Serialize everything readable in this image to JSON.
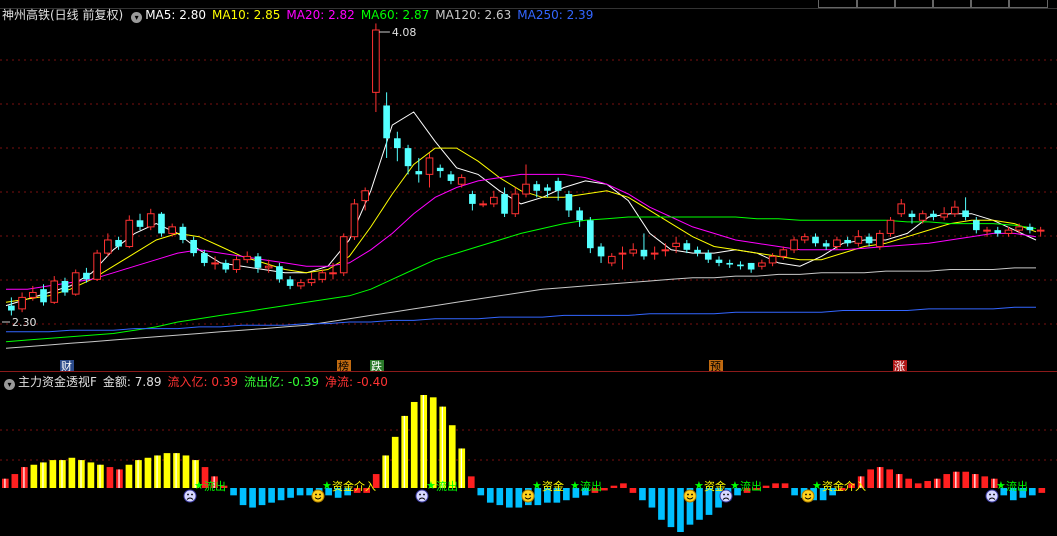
{
  "main_legend": {
    "title": "神州高铁(日线 前复权)",
    "items": [
      {
        "label": "MA5: 2.80",
        "color": "#ffffff"
      },
      {
        "label": "MA10: 2.85",
        "color": "#ffff00"
      },
      {
        "label": "MA20: 2.82",
        "color": "#ff00ff"
      },
      {
        "label": "MA60: 2.87",
        "color": "#00ff00"
      },
      {
        "label": "MA120: 2.63",
        "color": "#c8c8c8"
      },
      {
        "label": "MA250: 2.39",
        "color": "#3366ff"
      }
    ]
  },
  "sub_legend": {
    "title": "主力资金透视F",
    "items": [
      {
        "label": "金额: 7.89",
        "color": "#e0e0e0"
      },
      {
        "label": "流入亿: 0.39",
        "color": "#ff3333"
      },
      {
        "label": "流出亿: -0.39",
        "color": "#33ff33"
      },
      {
        "label": "净流: -0.40",
        "color": "#ff3333"
      }
    ]
  },
  "annotations": {
    "high_price": "4.08",
    "low_price": "2.30"
  },
  "event_tags": [
    {
      "label": "财",
      "bg": "#2a4a8a",
      "color": "#ffffff"
    },
    {
      "label": "榜",
      "bg": "#c06a10",
      "color": "#000000"
    },
    {
      "label": "跌",
      "bg": "#2a7a2a",
      "color": "#ffffff"
    },
    {
      "label": "预",
      "bg": "#c06a10",
      "color": "#000000"
    },
    {
      "label": "涨",
      "bg": "#b01818",
      "color": "#ffffff"
    }
  ],
  "signals": [
    {
      "face": "sad",
      "text": "流出",
      "text_color": "#00ff00"
    },
    {
      "face": "happy",
      "text": "资金介入",
      "text_color": "#ffff00"
    },
    {
      "face": "sad",
      "text": "流出",
      "text_color": "#00ff00"
    },
    {
      "face": "happy",
      "text": "资金",
      "text_color": "#ffff00"
    },
    {
      "face": "none",
      "text": "流出",
      "text_color": "#00ff00"
    },
    {
      "face": "happy",
      "text": "资金",
      "text_color": "#ffff00"
    },
    {
      "face": "sad",
      "text": "流出",
      "text_color": "#00ff00"
    },
    {
      "face": "happy",
      "text": "资金介入",
      "text_color": "#ffff00"
    },
    {
      "face": "sad",
      "text": "流出",
      "text_color": "#00ff00"
    }
  ],
  "colors": {
    "up_candle": "#ff3232",
    "down_candle": "#54ffff",
    "inflow_bar": "#ff2020",
    "inflow_bar_strong": "#ffff00",
    "outflow_bar": "#00c0ff",
    "grid": "#7a1010"
  },
  "chart_data": {
    "type": "candlestick",
    "y_axis_prices": [
      2.3,
      4.08
    ],
    "candles": [
      [
        2.4,
        2.37,
        2.45,
        2.34
      ],
      [
        2.38,
        2.45,
        2.48,
        2.36
      ],
      [
        2.45,
        2.48,
        2.52,
        2.43
      ],
      [
        2.5,
        2.42,
        2.53,
        2.4
      ],
      [
        2.42,
        2.55,
        2.58,
        2.41
      ],
      [
        2.55,
        2.48,
        2.57,
        2.46
      ],
      [
        2.47,
        2.6,
        2.62,
        2.46
      ],
      [
        2.6,
        2.56,
        2.63,
        2.54
      ],
      [
        2.56,
        2.72,
        2.74,
        2.55
      ],
      [
        2.72,
        2.8,
        2.84,
        2.7
      ],
      [
        2.8,
        2.76,
        2.82,
        2.74
      ],
      [
        2.76,
        2.92,
        2.95,
        2.75
      ],
      [
        2.92,
        2.88,
        2.96,
        2.86
      ],
      [
        2.88,
        2.96,
        2.99,
        2.86
      ],
      [
        2.96,
        2.84,
        2.97,
        2.82
      ],
      [
        2.84,
        2.88,
        2.9,
        2.82
      ],
      [
        2.88,
        2.8,
        2.9,
        2.78
      ],
      [
        2.8,
        2.72,
        2.82,
        2.7
      ],
      [
        2.72,
        2.66,
        2.74,
        2.64
      ],
      [
        2.66,
        2.66,
        2.7,
        2.62
      ],
      [
        2.66,
        2.62,
        2.68,
        2.6
      ],
      [
        2.62,
        2.68,
        2.7,
        2.6
      ],
      [
        2.68,
        2.7,
        2.73,
        2.66
      ],
      [
        2.7,
        2.63,
        2.72,
        2.6
      ],
      [
        2.63,
        2.64,
        2.68,
        2.6
      ],
      [
        2.64,
        2.56,
        2.66,
        2.54
      ],
      [
        2.56,
        2.52,
        2.58,
        2.5
      ],
      [
        2.52,
        2.54,
        2.56,
        2.5
      ],
      [
        2.54,
        2.56,
        2.6,
        2.52
      ],
      [
        2.56,
        2.6,
        2.62,
        2.54
      ],
      [
        2.6,
        2.6,
        2.66,
        2.56
      ],
      [
        2.6,
        2.82,
        2.84,
        2.58
      ],
      [
        2.82,
        3.02,
        3.05,
        2.8
      ],
      [
        3.04,
        3.1,
        3.12,
        2.98
      ],
      [
        3.7,
        4.08,
        4.12,
        3.58
      ],
      [
        3.62,
        3.42,
        3.7,
        3.3
      ],
      [
        3.42,
        3.36,
        3.46,
        3.28
      ],
      [
        3.36,
        3.25,
        3.38,
        3.2
      ],
      [
        3.22,
        3.2,
        3.3,
        3.15
      ],
      [
        3.2,
        3.3,
        3.33,
        3.12
      ],
      [
        3.24,
        3.22,
        3.26,
        3.18
      ],
      [
        3.2,
        3.16,
        3.22,
        3.14
      ],
      [
        3.14,
        3.18,
        3.2,
        3.12
      ],
      [
        3.08,
        3.02,
        3.1,
        2.98
      ],
      [
        3.02,
        3.02,
        3.04,
        3.0
      ],
      [
        3.02,
        3.06,
        3.1,
        3.0
      ],
      [
        3.08,
        2.96,
        3.12,
        2.94
      ],
      [
        2.96,
        3.08,
        3.12,
        2.94
      ],
      [
        3.08,
        3.14,
        3.26,
        3.06
      ],
      [
        3.14,
        3.1,
        3.16,
        3.06
      ],
      [
        3.12,
        3.1,
        3.14,
        3.06
      ],
      [
        3.16,
        3.1,
        3.18,
        3.04
      ],
      [
        3.08,
        2.98,
        3.1,
        2.94
      ],
      [
        2.98,
        2.92,
        3.0,
        2.88
      ],
      [
        2.92,
        2.75,
        2.94,
        2.72
      ],
      [
        2.76,
        2.7,
        2.78,
        2.66
      ],
      [
        2.66,
        2.7,
        2.72,
        2.64
      ],
      [
        2.72,
        2.72,
        2.76,
        2.62
      ],
      [
        2.72,
        2.74,
        2.78,
        2.7
      ],
      [
        2.74,
        2.7,
        2.84,
        2.68
      ],
      [
        2.72,
        2.72,
        2.76,
        2.68
      ],
      [
        2.74,
        2.74,
        2.78,
        2.7
      ],
      [
        2.76,
        2.78,
        2.82,
        2.72
      ],
      [
        2.78,
        2.74,
        2.8,
        2.72
      ],
      [
        2.74,
        2.72,
        2.76,
        2.7
      ],
      [
        2.72,
        2.68,
        2.74,
        2.66
      ],
      [
        2.68,
        2.66,
        2.7,
        2.64
      ],
      [
        2.66,
        2.65,
        2.68,
        2.63
      ],
      [
        2.65,
        2.64,
        2.67,
        2.62
      ],
      [
        2.66,
        2.62,
        2.66,
        2.6
      ],
      [
        2.64,
        2.66,
        2.68,
        2.62
      ],
      [
        2.66,
        2.7,
        2.72,
        2.64
      ],
      [
        2.7,
        2.74,
        2.76,
        2.68
      ],
      [
        2.74,
        2.8,
        2.82,
        2.72
      ],
      [
        2.8,
        2.82,
        2.84,
        2.78
      ],
      [
        2.82,
        2.78,
        2.84,
        2.76
      ],
      [
        2.78,
        2.76,
        2.8,
        2.74
      ],
      [
        2.76,
        2.8,
        2.82,
        2.74
      ],
      [
        2.8,
        2.78,
        2.82,
        2.76
      ],
      [
        2.78,
        2.82,
        2.86,
        2.76
      ],
      [
        2.82,
        2.78,
        2.84,
        2.76
      ],
      [
        2.76,
        2.84,
        2.86,
        2.74
      ],
      [
        2.84,
        2.92,
        2.94,
        2.82
      ],
      [
        2.96,
        3.02,
        3.05,
        2.94
      ],
      [
        2.96,
        2.94,
        2.98,
        2.9
      ],
      [
        2.92,
        2.96,
        2.98,
        2.9
      ],
      [
        2.96,
        2.94,
        2.98,
        2.92
      ],
      [
        2.94,
        2.96,
        3.0,
        2.92
      ],
      [
        2.96,
        3.0,
        3.04,
        2.94
      ],
      [
        2.98,
        2.94,
        3.06,
        2.92
      ],
      [
        2.92,
        2.86,
        2.94,
        2.84
      ],
      [
        2.86,
        2.86,
        2.88,
        2.82
      ],
      [
        2.86,
        2.84,
        2.88,
        2.82
      ],
      [
        2.84,
        2.86,
        2.88,
        2.82
      ],
      [
        2.86,
        2.88,
        2.9,
        2.84
      ],
      [
        2.88,
        2.86,
        2.9,
        2.84
      ],
      [
        2.86,
        2.86,
        2.88,
        2.82
      ]
    ],
    "ma_series": [
      {
        "name": "MA5",
        "color": "#ffffff",
        "values": [
          2.4,
          2.44,
          2.48,
          2.52,
          2.6,
          2.74,
          2.84,
          2.9,
          2.84,
          2.74,
          2.66,
          2.64,
          2.62,
          2.6,
          2.6,
          2.64,
          2.8,
          3.1,
          3.5,
          3.58,
          3.4,
          3.24,
          3.2,
          3.1,
          3.02,
          3.06,
          3.12,
          3.16,
          3.14,
          3.04,
          2.84,
          2.74,
          2.72,
          2.72,
          2.74,
          2.72,
          2.66,
          2.64,
          2.7,
          2.78,
          2.8,
          2.8,
          2.84,
          2.94,
          2.96,
          2.96,
          2.92,
          2.86,
          2.8
        ]
      },
      {
        "name": "MA10",
        "color": "#ffff00",
        "values": [
          2.42,
          2.44,
          2.46,
          2.5,
          2.56,
          2.64,
          2.72,
          2.8,
          2.84,
          2.82,
          2.76,
          2.7,
          2.66,
          2.62,
          2.6,
          2.62,
          2.7,
          2.88,
          3.08,
          3.26,
          3.36,
          3.36,
          3.28,
          3.18,
          3.1,
          3.06,
          3.06,
          3.08,
          3.1,
          3.06,
          2.98,
          2.9,
          2.82,
          2.76,
          2.74,
          2.72,
          2.7,
          2.68,
          2.68,
          2.72,
          2.76,
          2.78,
          2.82,
          2.86,
          2.9,
          2.92,
          2.92,
          2.9,
          2.85
        ]
      },
      {
        "name": "MA20",
        "color": "#ff00ff",
        "values": [
          2.5,
          2.5,
          2.52,
          2.54,
          2.56,
          2.6,
          2.64,
          2.68,
          2.72,
          2.74,
          2.72,
          2.7,
          2.68,
          2.66,
          2.64,
          2.64,
          2.66,
          2.74,
          2.84,
          2.96,
          3.06,
          3.12,
          3.16,
          3.18,
          3.2,
          3.2,
          3.2,
          3.18,
          3.14,
          3.08,
          3.0,
          2.94,
          2.88,
          2.84,
          2.8,
          2.78,
          2.76,
          2.74,
          2.74,
          2.74,
          2.75,
          2.76,
          2.77,
          2.78,
          2.8,
          2.82,
          2.84,
          2.84,
          2.82
        ]
      },
      {
        "name": "MA60",
        "color": "#00ff00",
        "values": [
          2.18,
          2.19,
          2.2,
          2.21,
          2.22,
          2.23,
          2.25,
          2.27,
          2.3,
          2.32,
          2.34,
          2.36,
          2.38,
          2.4,
          2.42,
          2.44,
          2.46,
          2.5,
          2.56,
          2.62,
          2.68,
          2.72,
          2.76,
          2.8,
          2.84,
          2.87,
          2.9,
          2.92,
          2.93,
          2.94,
          2.94,
          2.94,
          2.94,
          2.94,
          2.94,
          2.93,
          2.93,
          2.92,
          2.92,
          2.92,
          2.92,
          2.92,
          2.91,
          2.91,
          2.9,
          2.9,
          2.9,
          2.89,
          2.87
        ]
      },
      {
        "name": "MA120",
        "color": "#c8c8c8",
        "values": [
          2.14,
          2.15,
          2.16,
          2.17,
          2.18,
          2.19,
          2.2,
          2.21,
          2.22,
          2.23,
          2.24,
          2.25,
          2.26,
          2.27,
          2.28,
          2.3,
          2.32,
          2.34,
          2.36,
          2.38,
          2.4,
          2.42,
          2.44,
          2.46,
          2.48,
          2.5,
          2.51,
          2.52,
          2.53,
          2.54,
          2.55,
          2.56,
          2.57,
          2.57,
          2.58,
          2.58,
          2.59,
          2.59,
          2.6,
          2.6,
          2.6,
          2.61,
          2.61,
          2.61,
          2.62,
          2.62,
          2.62,
          2.63,
          2.63
        ]
      },
      {
        "name": "MA250",
        "color": "#3366ff",
        "values": [
          2.24,
          2.24,
          2.24,
          2.25,
          2.25,
          2.25,
          2.26,
          2.26,
          2.26,
          2.27,
          2.27,
          2.28,
          2.28,
          2.28,
          2.29,
          2.29,
          2.3,
          2.3,
          2.31,
          2.31,
          2.32,
          2.32,
          2.32,
          2.33,
          2.33,
          2.33,
          2.34,
          2.34,
          2.34,
          2.34,
          2.35,
          2.35,
          2.35,
          2.35,
          2.36,
          2.36,
          2.36,
          2.36,
          2.36,
          2.37,
          2.37,
          2.37,
          2.37,
          2.38,
          2.38,
          2.38,
          2.38,
          2.39,
          2.39
        ]
      }
    ],
    "fund_flow": [
      0.08,
      0.12,
      0.18,
      0.2,
      0.22,
      0.24,
      0.24,
      0.26,
      0.24,
      0.22,
      0.2,
      0.18,
      0.16,
      0.2,
      0.24,
      0.26,
      0.28,
      0.3,
      0.3,
      0.28,
      0.24,
      0.18,
      0.1,
      0.02,
      -0.06,
      -0.14,
      -0.16,
      -0.14,
      -0.12,
      -0.1,
      -0.08,
      -0.06,
      -0.06,
      -0.06,
      -0.06,
      -0.08,
      -0.06,
      -0.04,
      -0.04,
      0.12,
      0.28,
      0.44,
      0.62,
      0.74,
      0.8,
      0.78,
      0.7,
      0.54,
      0.34,
      0.1,
      -0.06,
      -0.12,
      -0.14,
      -0.16,
      -0.16,
      -0.14,
      -0.14,
      -0.12,
      -0.12,
      -0.1,
      -0.08,
      -0.06,
      -0.04,
      -0.02,
      0.02,
      0.04,
      -0.04,
      -0.1,
      -0.16,
      -0.26,
      -0.32,
      -0.36,
      -0.3,
      -0.26,
      -0.22,
      -0.16,
      -0.1,
      -0.06,
      -0.04,
      -0.02,
      0.02,
      0.04,
      0.04,
      -0.06,
      -0.08,
      -0.1,
      -0.1,
      -0.06,
      -0.02,
      0.04,
      0.1,
      0.16,
      0.18,
      0.16,
      0.12,
      0.08,
      0.04,
      0.06,
      0.08,
      0.12,
      0.14,
      0.14,
      0.12,
      0.1,
      0.08,
      -0.06,
      -0.1,
      -0.08,
      -0.06,
      -0.04
    ]
  }
}
